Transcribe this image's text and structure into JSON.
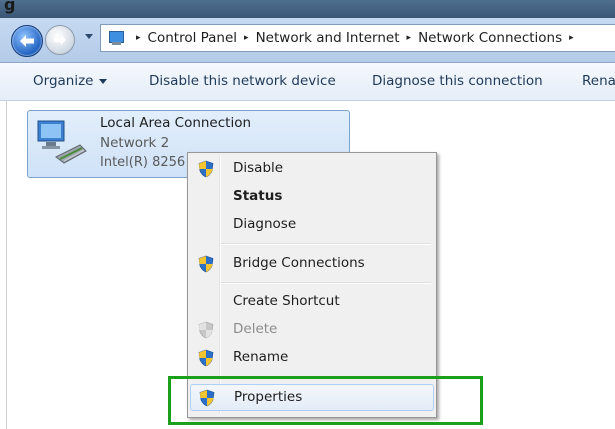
{
  "window": {
    "title_fragment": "g"
  },
  "address_bar": {
    "breadcrumbs": [
      "Control Panel",
      "Network and Internet",
      "Network Connections"
    ],
    "separator": "▸"
  },
  "toolbar": {
    "organize_label": "Organize",
    "disable_label": "Disable this network device",
    "diagnose_label": "Diagnose this connection",
    "rename_label": "Rena"
  },
  "connection": {
    "name": "Local Area Connection",
    "network": "Network  2",
    "device": "Intel(R) 8256"
  },
  "context_menu": {
    "items": [
      {
        "label": "Disable",
        "icon": "shield-icon",
        "bold": false,
        "disabled": false
      },
      {
        "label": "Status",
        "icon": null,
        "bold": true,
        "disabled": false
      },
      {
        "label": "Diagnose",
        "icon": null,
        "bold": false,
        "disabled": false
      },
      {
        "label": "Bridge Connections",
        "icon": "shield-icon",
        "bold": false,
        "disabled": false
      },
      {
        "label": "Create Shortcut",
        "icon": null,
        "bold": false,
        "disabled": false
      },
      {
        "label": "Delete",
        "icon": "shield-icon",
        "bold": false,
        "disabled": true
      },
      {
        "label": "Rename",
        "icon": "shield-icon",
        "bold": false,
        "disabled": false
      },
      {
        "label": "Properties",
        "icon": "shield-icon",
        "bold": false,
        "disabled": false,
        "hovered": true
      }
    ]
  },
  "colors": {
    "highlight_box": "#1aa01a",
    "shield_blue": "#2c6fc7",
    "shield_yellow": "#f4c430"
  }
}
